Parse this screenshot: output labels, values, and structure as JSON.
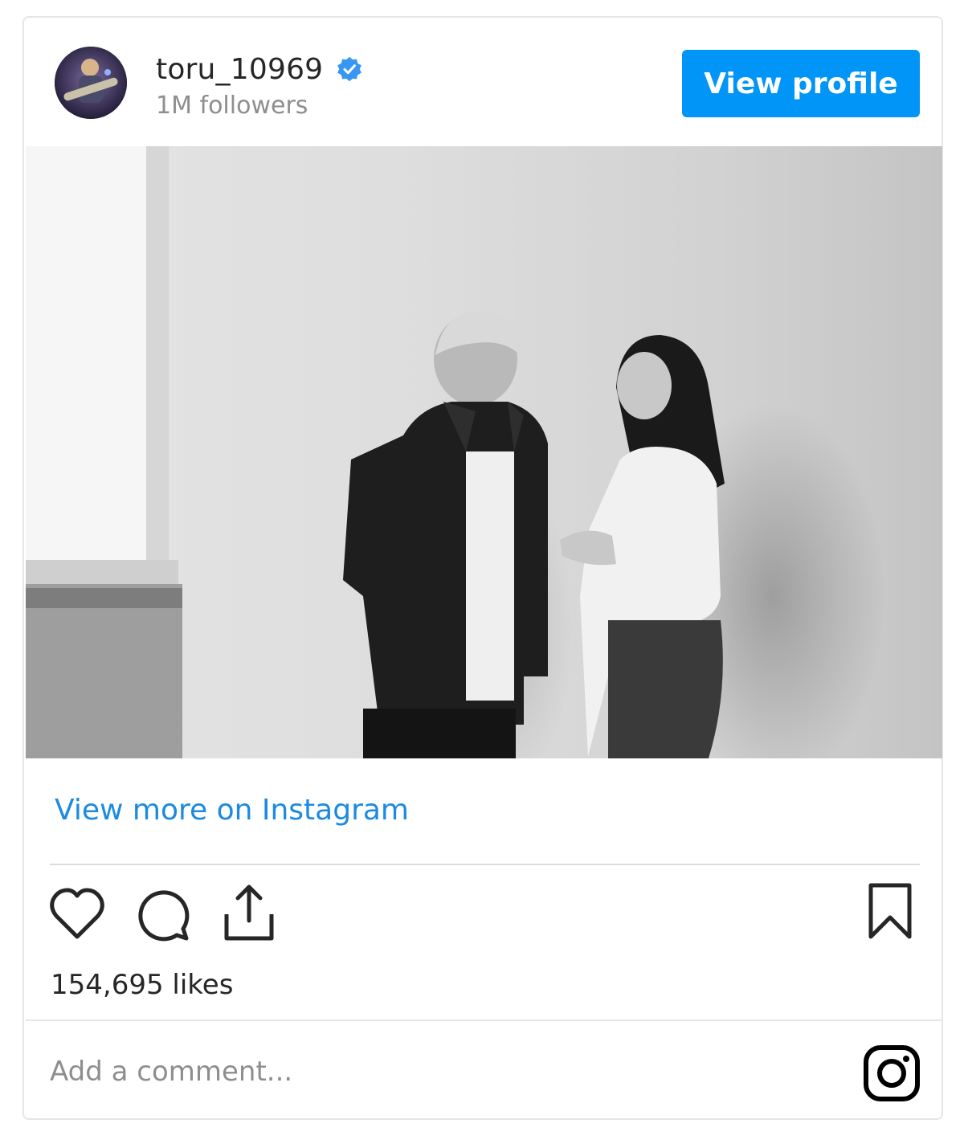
{
  "post": {
    "username": "toru_10969",
    "followers": "1M followers",
    "view_profile_label": "View profile",
    "view_more_label": "View more on Instagram",
    "likes": "154,695 likes",
    "comment_placeholder": "Add a comment..."
  },
  "icons": {
    "verified": "verified-badge-icon",
    "like": "heart-icon",
    "comment": "comment-bubble-icon",
    "share": "share-icon",
    "save": "bookmark-icon",
    "brand": "instagram-icon"
  },
  "colors": {
    "accent": "#0095f6",
    "link": "#1b8ae0",
    "muted": "#8e8e8e",
    "text": "#262626"
  }
}
